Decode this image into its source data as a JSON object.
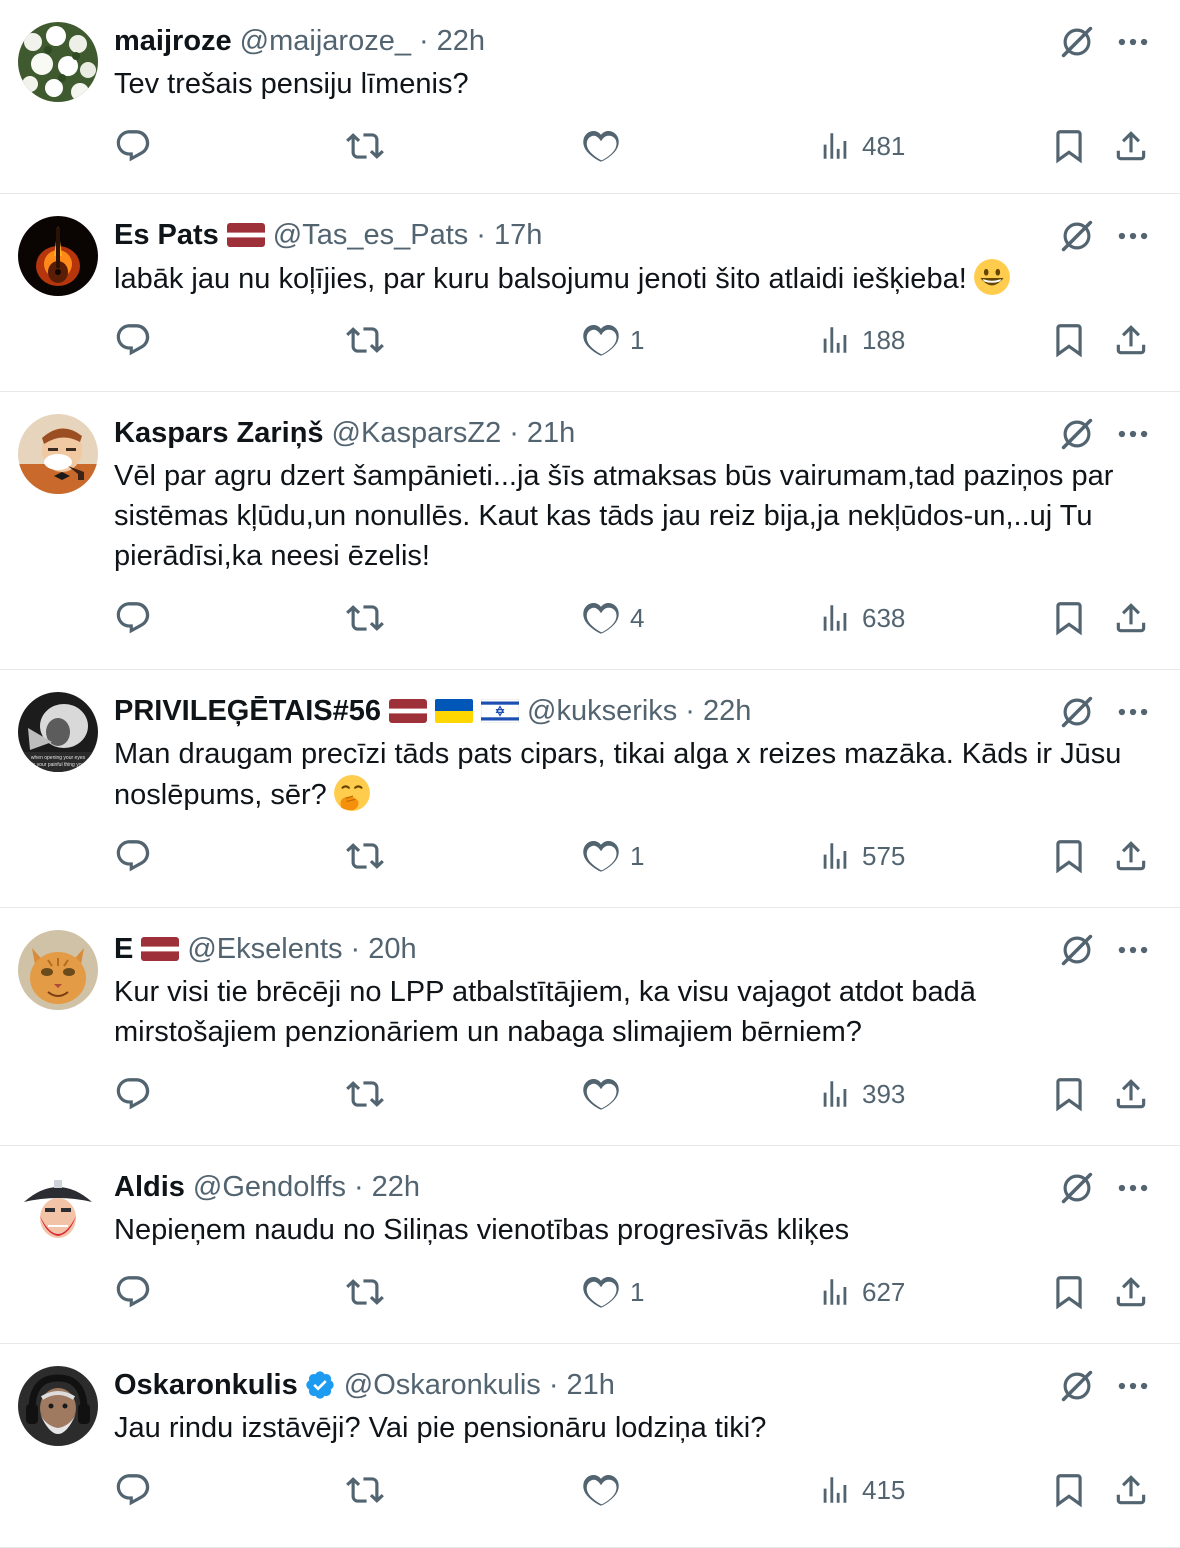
{
  "tweets": [
    {
      "name": "maijroze",
      "handle": "@maijaroze_",
      "sep": "·",
      "time": "22h",
      "text": "Tev trešais pensiju līmenis?",
      "flags": [],
      "verified": false,
      "emoji": "",
      "likes": "",
      "views": "481",
      "avatar": "flowers"
    },
    {
      "name": "Es Pats",
      "handle": "@Tas_es_Pats",
      "sep": "·",
      "time": "17h",
      "text": "labāk jau nu koļījies, par kuru balsojumu jenoti šito atlaidi iešķieba!",
      "flags": [
        "latvia"
      ],
      "verified": false,
      "emoji": "grinning-face",
      "likes": "1",
      "views": "188",
      "avatar": "flaming-guitar"
    },
    {
      "name": "Kaspars Zariņš",
      "handle": "@KasparsZ2",
      "sep": "·",
      "time": "21h",
      "text": "Vēl par agru dzert šampānieti...ja šīs atmaksas būs vairumam,tad paziņos par sistēmas kļūdu,un nonullēs. Kaut kas tāds jau reiz bija,ja nekļūdos-un,..uj Tu pierādīsi,ka neesi ēzelis!",
      "flags": [],
      "verified": false,
      "emoji": "",
      "likes": "4",
      "views": "638",
      "avatar": "old-man-pipe"
    },
    {
      "name": "PRIVILEĢĒTAIS#56",
      "handle": "@kukseriks",
      "sep": "·",
      "time": "22h",
      "text": "Man draugam precīzi tāds pats cipars, tikai alga x reizes mazāka. Kāds ir Jūsu noslēpums, sēr?",
      "flags": [
        "latvia",
        "ukraine",
        "israel"
      ],
      "verified": false,
      "emoji": "hand-over-mouth",
      "likes": "1",
      "views": "575",
      "avatar": "bw-photo",
      "avatar_caption": "when opening your eyes is your painful thing you"
    },
    {
      "name": "E",
      "handle": "@Ekselents",
      "sep": "·",
      "time": "20h",
      "text": "Kur visi tie brēcēji no LPP atbalstītājiem, ka visu vajagot atdot badā mirstošajiem penzionāriem un nabaga slimajiem bērniem?",
      "flags": [
        "latvia"
      ],
      "verified": false,
      "emoji": "",
      "likes": "",
      "views": "393",
      "avatar": "ginger-cat"
    },
    {
      "name": "Aldis",
      "handle": "@Gendolffs",
      "sep": "·",
      "time": "22h",
      "text": "Nepieņem naudu no Siliņas vienotības progresīvās kliķes",
      "flags": [],
      "verified": false,
      "emoji": "",
      "likes": "1",
      "views": "627",
      "avatar": "pirate"
    },
    {
      "name": "Oskaronkulis",
      "handle": "@Oskaronkulis",
      "sep": "·",
      "time": "21h",
      "text": "Jau rindu izstāvēji? Vai pie pensionāru lodziņa tiki?",
      "flags": [],
      "verified": true,
      "emoji": "",
      "likes": "",
      "views": "415",
      "avatar": "old-man-headphones"
    }
  ],
  "icons": {
    "reply": "reply-icon",
    "retweet": "retweet-icon",
    "like": "heart-icon",
    "views": "views-icon",
    "bookmark": "bookmark-icon",
    "share": "share-icon",
    "grok": "grok-icon",
    "more": "more-icon",
    "verified": "verified-badge-icon"
  },
  "colors": {
    "text": "#0f1419",
    "secondary": "#536471",
    "divider": "#e6e9ea",
    "verified": "#1d9bf0"
  }
}
